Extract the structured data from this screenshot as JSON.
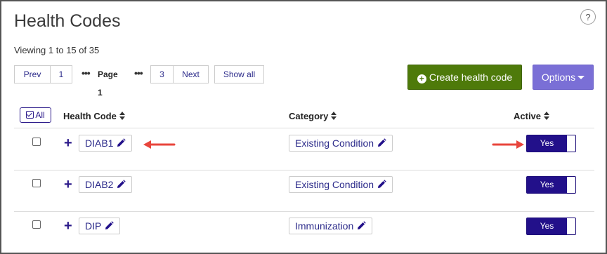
{
  "page": {
    "title": "Health Codes",
    "help_label": "?",
    "viewing_text": "Viewing 1 to 15 of 35"
  },
  "pagination": {
    "prev": "Prev",
    "first_page": "1",
    "ellipsis_left": "•••",
    "current": "Page 1",
    "ellipsis_right": "•••",
    "last_page": "3",
    "next": "Next",
    "show_all": "Show all"
  },
  "actions": {
    "create_label": "Create health code",
    "create_icon": "plus-circle-icon",
    "options_label": "Options",
    "options_icon": "caret-down-icon"
  },
  "table": {
    "select_all_label": "All",
    "columns": [
      "Health Code",
      "Category",
      "Active"
    ],
    "rows": [
      {
        "code": "DIAB1",
        "category": "Existing Condition",
        "active": "Yes"
      },
      {
        "code": "DIAB2",
        "category": "Existing Condition",
        "active": "Yes"
      },
      {
        "code": "DIP",
        "category": "Immunization",
        "active": "Yes"
      }
    ]
  },
  "colors": {
    "primary": "#22108a",
    "create_green": "#4e7a0a",
    "options_purple": "#7a6fd6",
    "annotation_red": "#e8453c"
  }
}
